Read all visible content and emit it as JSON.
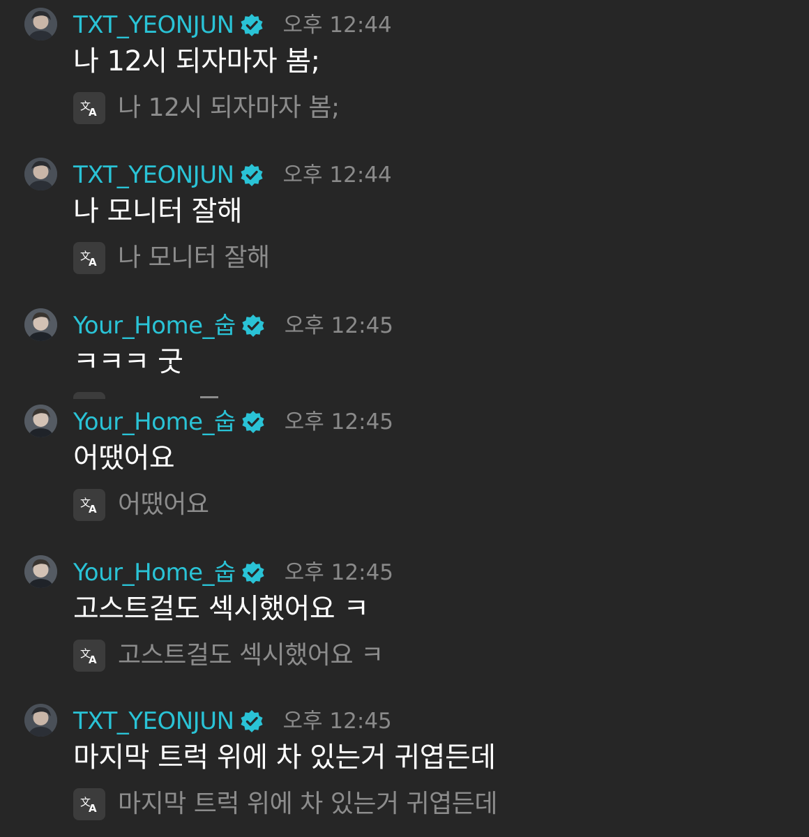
{
  "messages": [
    {
      "username": "TXT_YEONJUN",
      "time": "오후 12:44",
      "text": "나 12시 되자마자 봄;",
      "translation": "나 12시 되자마자 봄;"
    },
    {
      "username": "TXT_YEONJUN",
      "time": "오후 12:44",
      "text": "나 모니터 잘해",
      "translation": "나 모니터 잘해"
    },
    {
      "username": "Your_Home_숩",
      "time": "오후 12:45",
      "text": "ㅋㅋㅋ 굿",
      "translation": ""
    },
    {
      "username": "Your_Home_숩",
      "time": "오후 12:45",
      "text": "어땠어요",
      "translation": "어땠어요"
    },
    {
      "username": "Your_Home_숩",
      "time": "오후 12:45",
      "text": "고스트걸도 섹시했어요 ㅋ",
      "translation": "고스트걸도 섹시했어요 ㅋ"
    },
    {
      "username": "TXT_YEONJUN",
      "time": "오후 12:45",
      "text": "마지막 트럭 위에 차 있는거 귀엽든데",
      "translation": "마지막 트럭 위에 차 있는거 귀엽든데"
    }
  ],
  "icons": {
    "verified": "verified-badge-icon",
    "translate": "translate-icon",
    "avatar": "user-avatar"
  },
  "colors": {
    "background": "#262626",
    "username": "#2ac3d6",
    "verified": "#2ac3d6",
    "message_text": "#ffffff",
    "timestamp": "#8a8a8a",
    "translation_text": "#8c8c8c",
    "translate_icon_bg": "#3c3c3c"
  }
}
